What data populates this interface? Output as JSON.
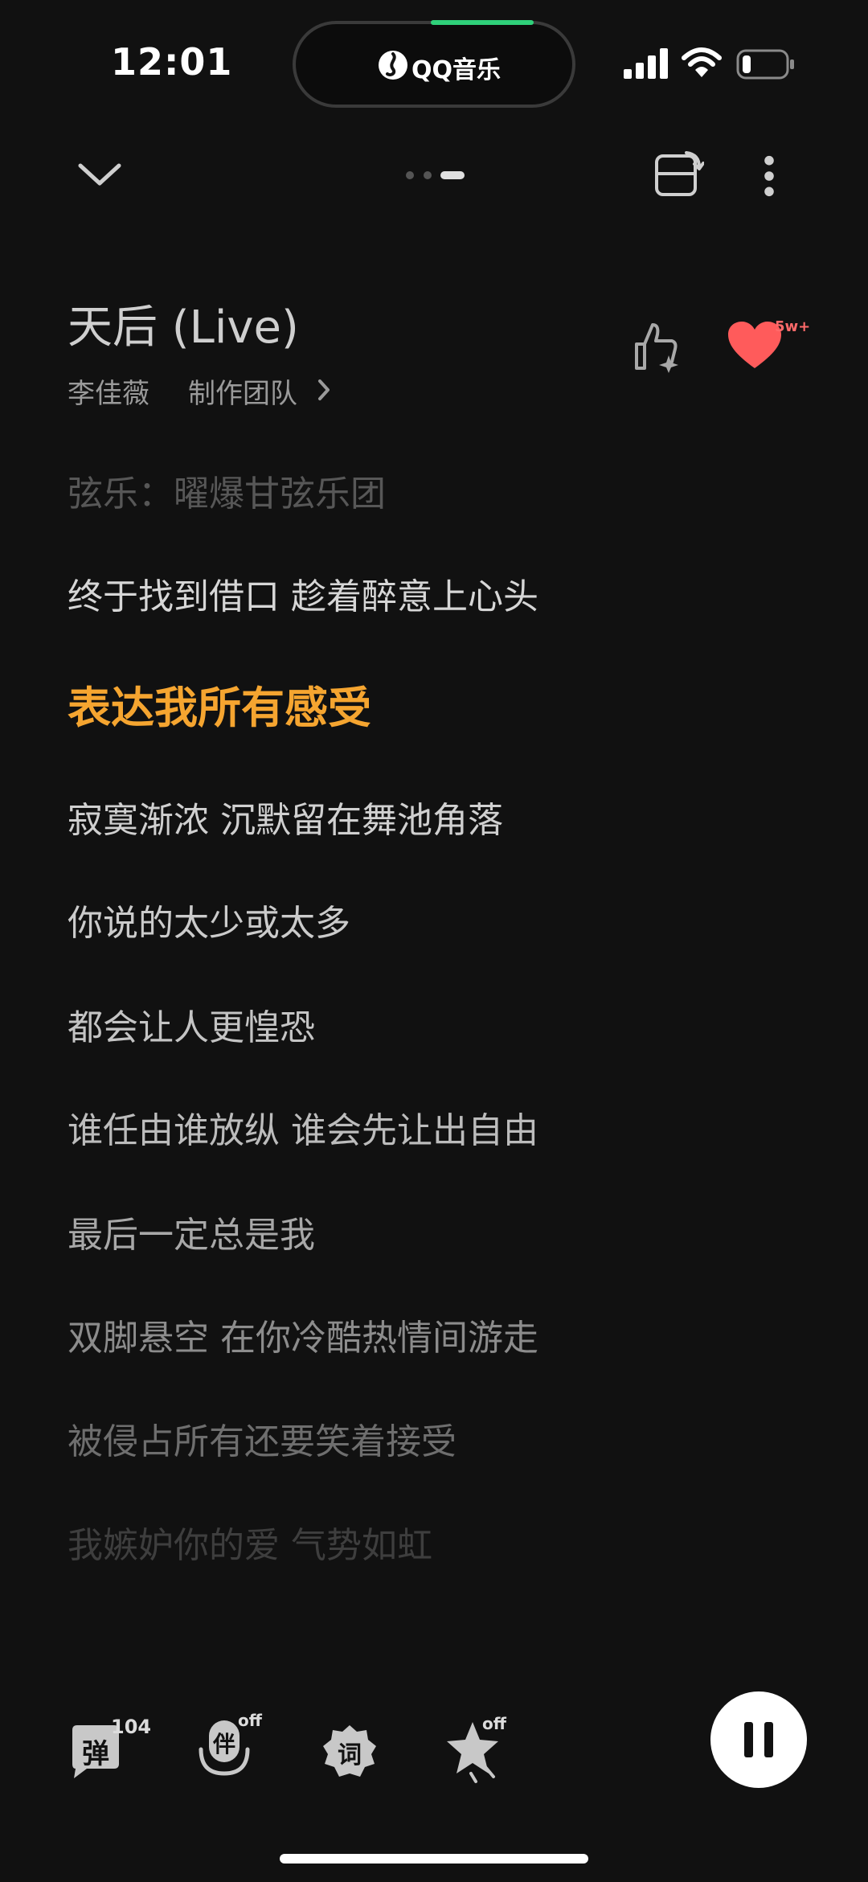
{
  "status_bar": {
    "time": "12:01",
    "island_label": "QQ音乐"
  },
  "song": {
    "title": "天后 (Live)",
    "artist": "李佳薇",
    "team_link": "制作团队",
    "like_count": "5w+"
  },
  "lyrics": {
    "lines": [
      "弦乐：曜爆甘弦乐团",
      "终于找到借口 趁着醉意上心头",
      "表达我所有感受",
      "寂寞渐浓 沉默留在舞池角落",
      "你说的太少或太多",
      "都会让人更惶恐",
      "谁任由谁放纵 谁会先让出自由",
      "最后一定总是我",
      "双脚悬空 在你冷酷热情间游走",
      "被侵占所有还要笑着接受",
      "我嫉妒你的爱 气势如虹"
    ],
    "colors": [
      "#575757",
      "#d6d6d6",
      "#f5a530",
      "#d0d0d0",
      "#cbcbcb",
      "#c4c4c4",
      "#bcbcbc",
      "#a8a8a8",
      "#8c8c8c",
      "#6e6e6e",
      "#3e3e3e"
    ]
  },
  "toolbar": {
    "danmaku_label": "弹",
    "danmaku_count": "104",
    "accompany_label": "伴",
    "accompany_state": "off",
    "lyrics_label": "词",
    "effects_state": "off"
  },
  "colors": {
    "accent": "#f5a530",
    "like": "#ff5b5b",
    "island_bar": "#2fd17a",
    "background": "#111111"
  },
  "icons": [
    "chevron-down-icon",
    "page-dots-icon",
    "rotate-screen-icon",
    "more-vertical-icon",
    "thumb-up-sparkle-icon",
    "heart-icon",
    "signal-icon",
    "wifi-icon",
    "battery-icon",
    "pause-icon"
  ]
}
